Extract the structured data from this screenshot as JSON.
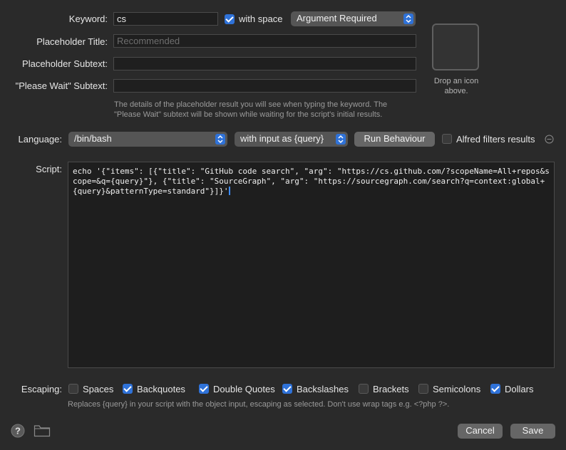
{
  "keyword": {
    "label": "Keyword:",
    "value": "cs",
    "with_space_label": "with space",
    "with_space_checked": true,
    "argument_mode": "Argument Required"
  },
  "placeholder_title": {
    "label": "Placeholder Title:",
    "value": "",
    "placeholder": "Recommended"
  },
  "placeholder_subtext": {
    "label": "Placeholder Subtext:",
    "value": ""
  },
  "please_wait_subtext": {
    "label": "\"Please Wait\" Subtext:",
    "value": ""
  },
  "placeholder_help": "The details of the placeholder result you will see when typing the keyword. The \"Please Wait\" subtext will be shown while waiting for the script's initial results.",
  "icon_drop": {
    "label": "Drop an icon above."
  },
  "language": {
    "label": "Language:",
    "value": "/bin/bash",
    "input_mode": "with input as {query}",
    "run_behaviour_button": "Run Behaviour",
    "alfred_filters_label": "Alfred filters results",
    "alfred_filters_checked": false
  },
  "script": {
    "label": "Script:",
    "content": "echo '{\"items\": [{\"title\": \"GitHub code search\", \"arg\": \"https://cs.github.com/?scopeName=All+repos&scope=&q={query}\"}, {\"title\": \"SourceGraph\", \"arg\": \"https://sourcegraph.com/search?q=context:global+{query}&patternType=standard\"}]}'"
  },
  "escaping": {
    "label": "Escaping:",
    "options": [
      {
        "label": "Spaces",
        "checked": false
      },
      {
        "label": "Backquotes",
        "checked": true
      },
      {
        "label": "Double Quotes",
        "checked": true
      },
      {
        "label": "Backslashes",
        "checked": true
      },
      {
        "label": "Brackets",
        "checked": false
      },
      {
        "label": "Semicolons",
        "checked": false
      },
      {
        "label": "Dollars",
        "checked": true
      }
    ],
    "help": "Replaces {query} in your script with the object input, escaping as selected. Don't use wrap tags e.g. <?php ?>."
  },
  "footer": {
    "help_icon": "question-icon",
    "folder_icon": "folder-icon",
    "cancel_button": "Cancel",
    "save_button": "Save"
  },
  "colors": {
    "accent": "#2f72d8",
    "background": "#2a2a2a",
    "field": "#1f1f1f"
  }
}
